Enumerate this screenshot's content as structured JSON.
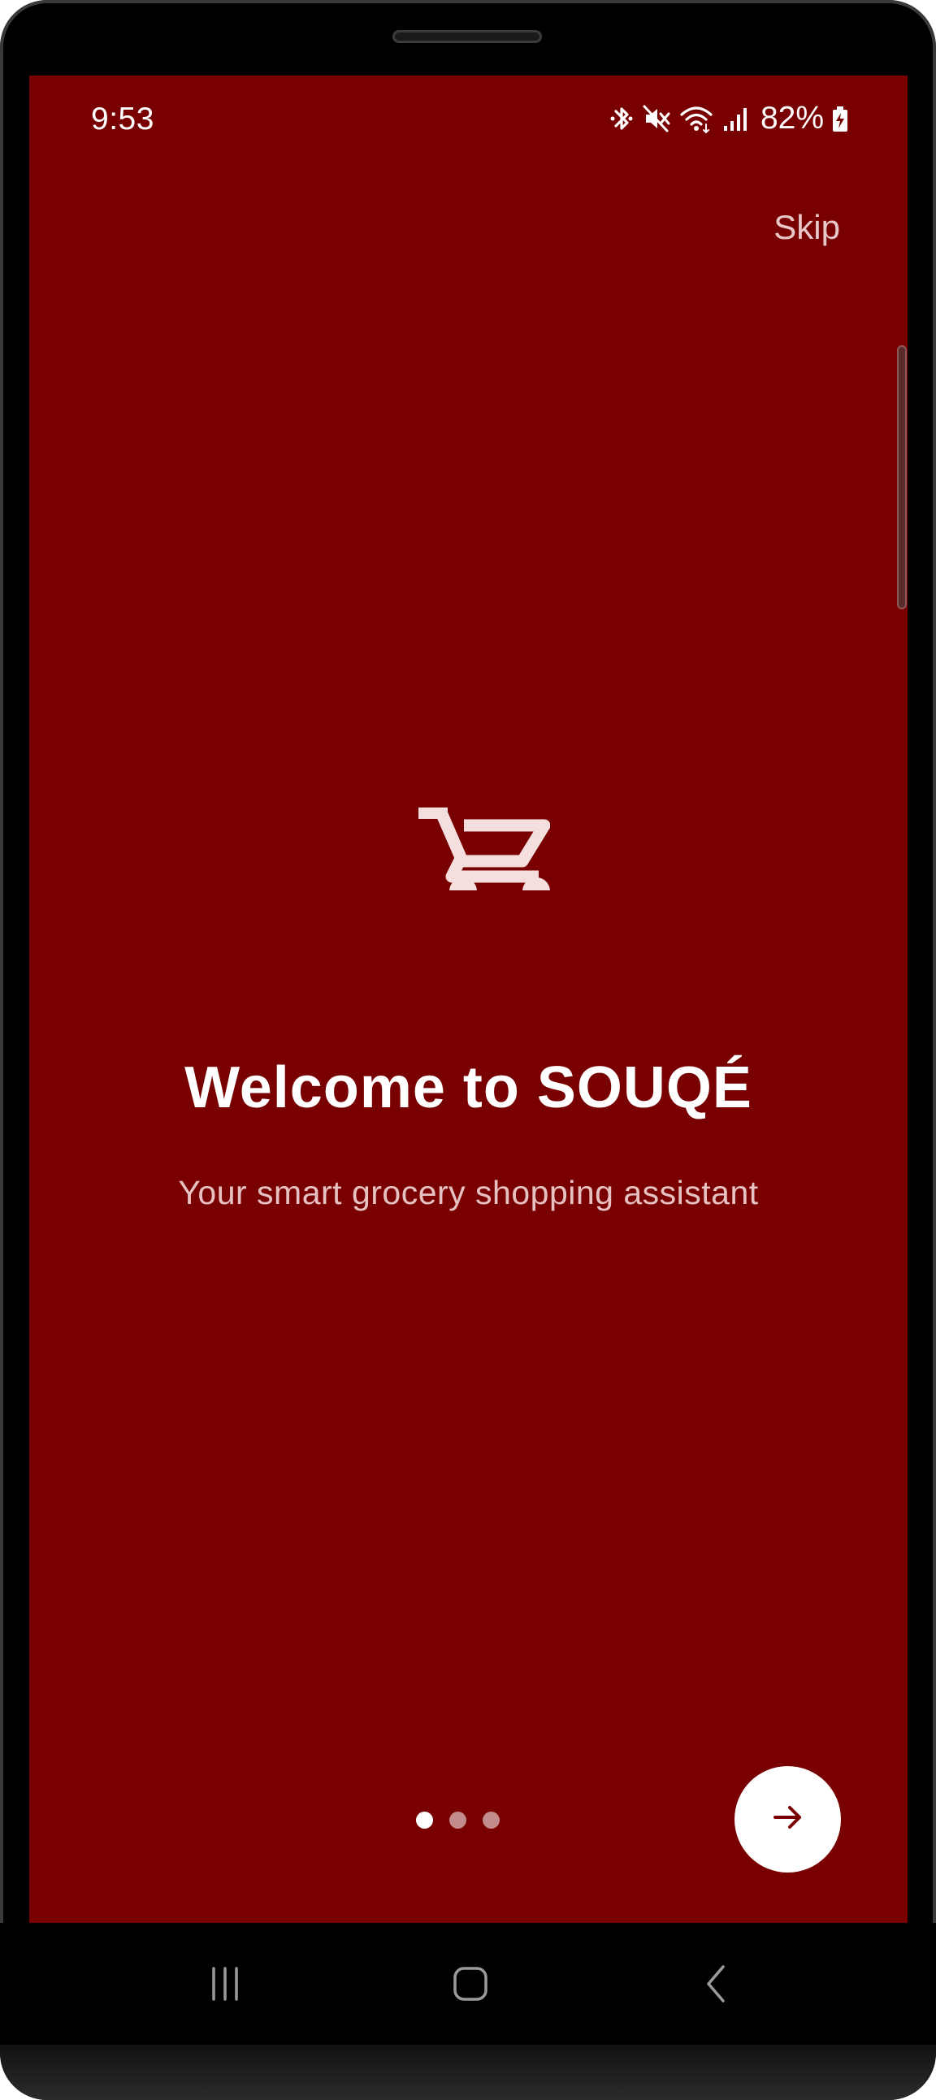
{
  "status_bar": {
    "time": "9:53",
    "battery_percent": "82%",
    "icons": [
      "bluetooth-icon",
      "mute-icon",
      "wifi-icon",
      "signal-icon",
      "battery-charging-icon"
    ]
  },
  "onboarding": {
    "skip_label": "Skip",
    "illustration_icon": "shopping-cart-icon",
    "title": "Welcome to SOUQÉ",
    "subtitle": "Your smart grocery shopping assistant",
    "page_indicator": {
      "total": 3,
      "current": 1
    },
    "next_button_icon": "arrow-right-icon"
  },
  "navigation_bar": {
    "buttons": [
      "recent-apps-icon",
      "home-icon",
      "back-icon"
    ]
  },
  "colors": {
    "background": "#790000",
    "title": "#ffffff",
    "subtitle": "#e7c2c2",
    "skip": "#e7c7c7",
    "cart": "#f5dede",
    "next_button_bg": "#ffffff",
    "next_arrow": "#790000"
  }
}
